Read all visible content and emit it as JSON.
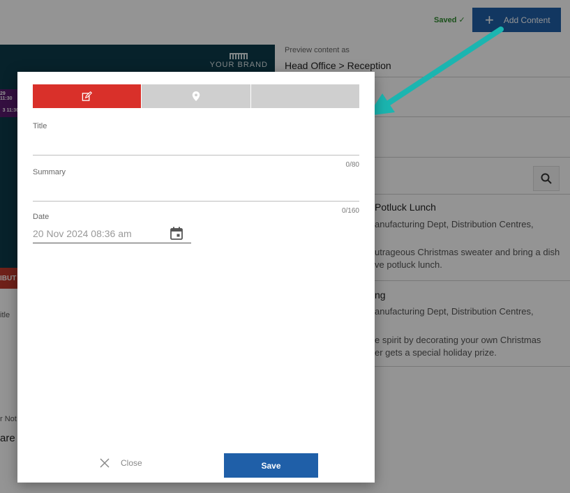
{
  "header": {
    "saved_label": "Saved ✓",
    "add_content_label": "Add Content"
  },
  "background": {
    "brand_line1": "YOUR BRAND",
    "badge1": "29 11:30",
    "badge2": "3 11:30",
    "red_strip_text": "IBUT",
    "preview_label": "Preview content as",
    "preview_value": "Head Office > Reception",
    "cards": [
      {
        "title": "Potluck Lunch",
        "line1": "anufacturing Dept, Distribution Centres,",
        "line2": "utrageous Christmas sweater and bring a dish",
        "line3": "ve potluck lunch."
      },
      {
        "title": "ng",
        "line1": "anufacturing Dept, Distribution Centres,",
        "line2": "e spirit by decorating your own Christmas",
        "line3": "er gets a special holiday prize."
      }
    ],
    "left_label_title": "itle",
    "left_label_not": "r Not",
    "left_big": "are"
  },
  "dialog": {
    "tabs": [
      {
        "icon": "edit-icon",
        "active": true
      },
      {
        "icon": "location-pin-icon",
        "active": false
      },
      {
        "icon": "",
        "active": false
      }
    ],
    "title_field": {
      "label": "Title",
      "value": "",
      "counter": "0/80"
    },
    "summary_field": {
      "label": "Summary",
      "value": "",
      "counter": "0/160"
    },
    "date_field": {
      "label": "Date",
      "value": "20 Nov 2024 08:36 am"
    },
    "close_label": "Close",
    "save_label": "Save"
  },
  "colors": {
    "accent_red": "#d9302a",
    "primary_blue": "#1f5fa8",
    "arrow_teal": "#1bb5b0"
  }
}
